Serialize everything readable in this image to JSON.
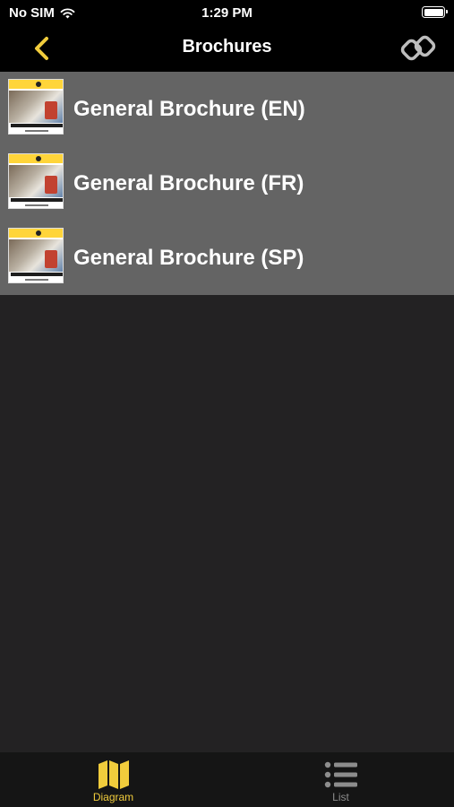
{
  "status_bar": {
    "carrier": "No SIM",
    "time": "1:29 PM"
  },
  "nav": {
    "title": "Brochures"
  },
  "brochures": [
    {
      "label": "General Brochure (EN)"
    },
    {
      "label": "General Brochure (FR)"
    },
    {
      "label": "General Brochure (SP)"
    }
  ],
  "tabs": [
    {
      "label": "Diagram",
      "icon": "map-icon",
      "selected": true
    },
    {
      "label": "List",
      "icon": "list-icon",
      "selected": false
    }
  ],
  "colors": {
    "accent": "#f1cc3c",
    "list_bg": "#646464",
    "background": "#232223",
    "bar_bg": "#000000",
    "tab_bg": "#151515",
    "inactive": "#8d8d8d"
  }
}
